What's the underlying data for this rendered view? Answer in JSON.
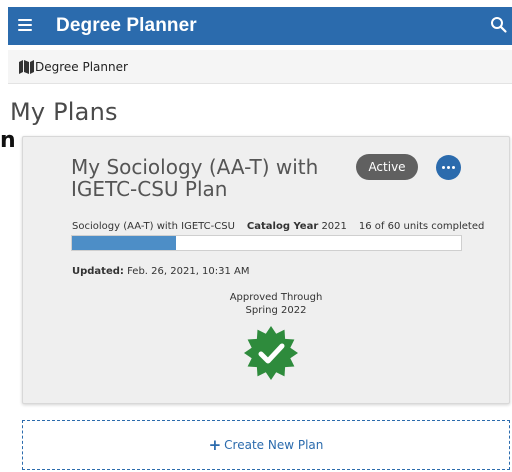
{
  "header": {
    "title": "Degree Planner",
    "menu_icon": "hamburger-icon",
    "search_icon": "search-icon",
    "color": "#2b6bad"
  },
  "breadcrumb": {
    "icon": "map-icon",
    "label": "Degree Planner"
  },
  "page": {
    "title": "My Plans",
    "side_glyph": "n"
  },
  "plan_card": {
    "title": "My Sociology (AA-T) with IGETC-CSU Plan",
    "status": "Active",
    "more_icon": "more-options-icon",
    "program": "Sociology (AA-T) with IGETC-CSU",
    "catalog_year_label": "Catalog Year",
    "catalog_year": "2021",
    "units_completed": "16 of 60 units completed",
    "progress": {
      "completed": 16,
      "total": 60,
      "fill_color": "#4d8ec7"
    },
    "updated_label": "Updated:",
    "updated_value": "Feb. 26, 2021, 10:31 AM",
    "approval_line1": "Approved Through",
    "approval_line2": "Spring 2022",
    "approval_icon": "approved-badge-icon",
    "approval_color": "#2e8b3c"
  },
  "create_plan": {
    "icon": "plus-icon",
    "label": "Create New Plan"
  }
}
